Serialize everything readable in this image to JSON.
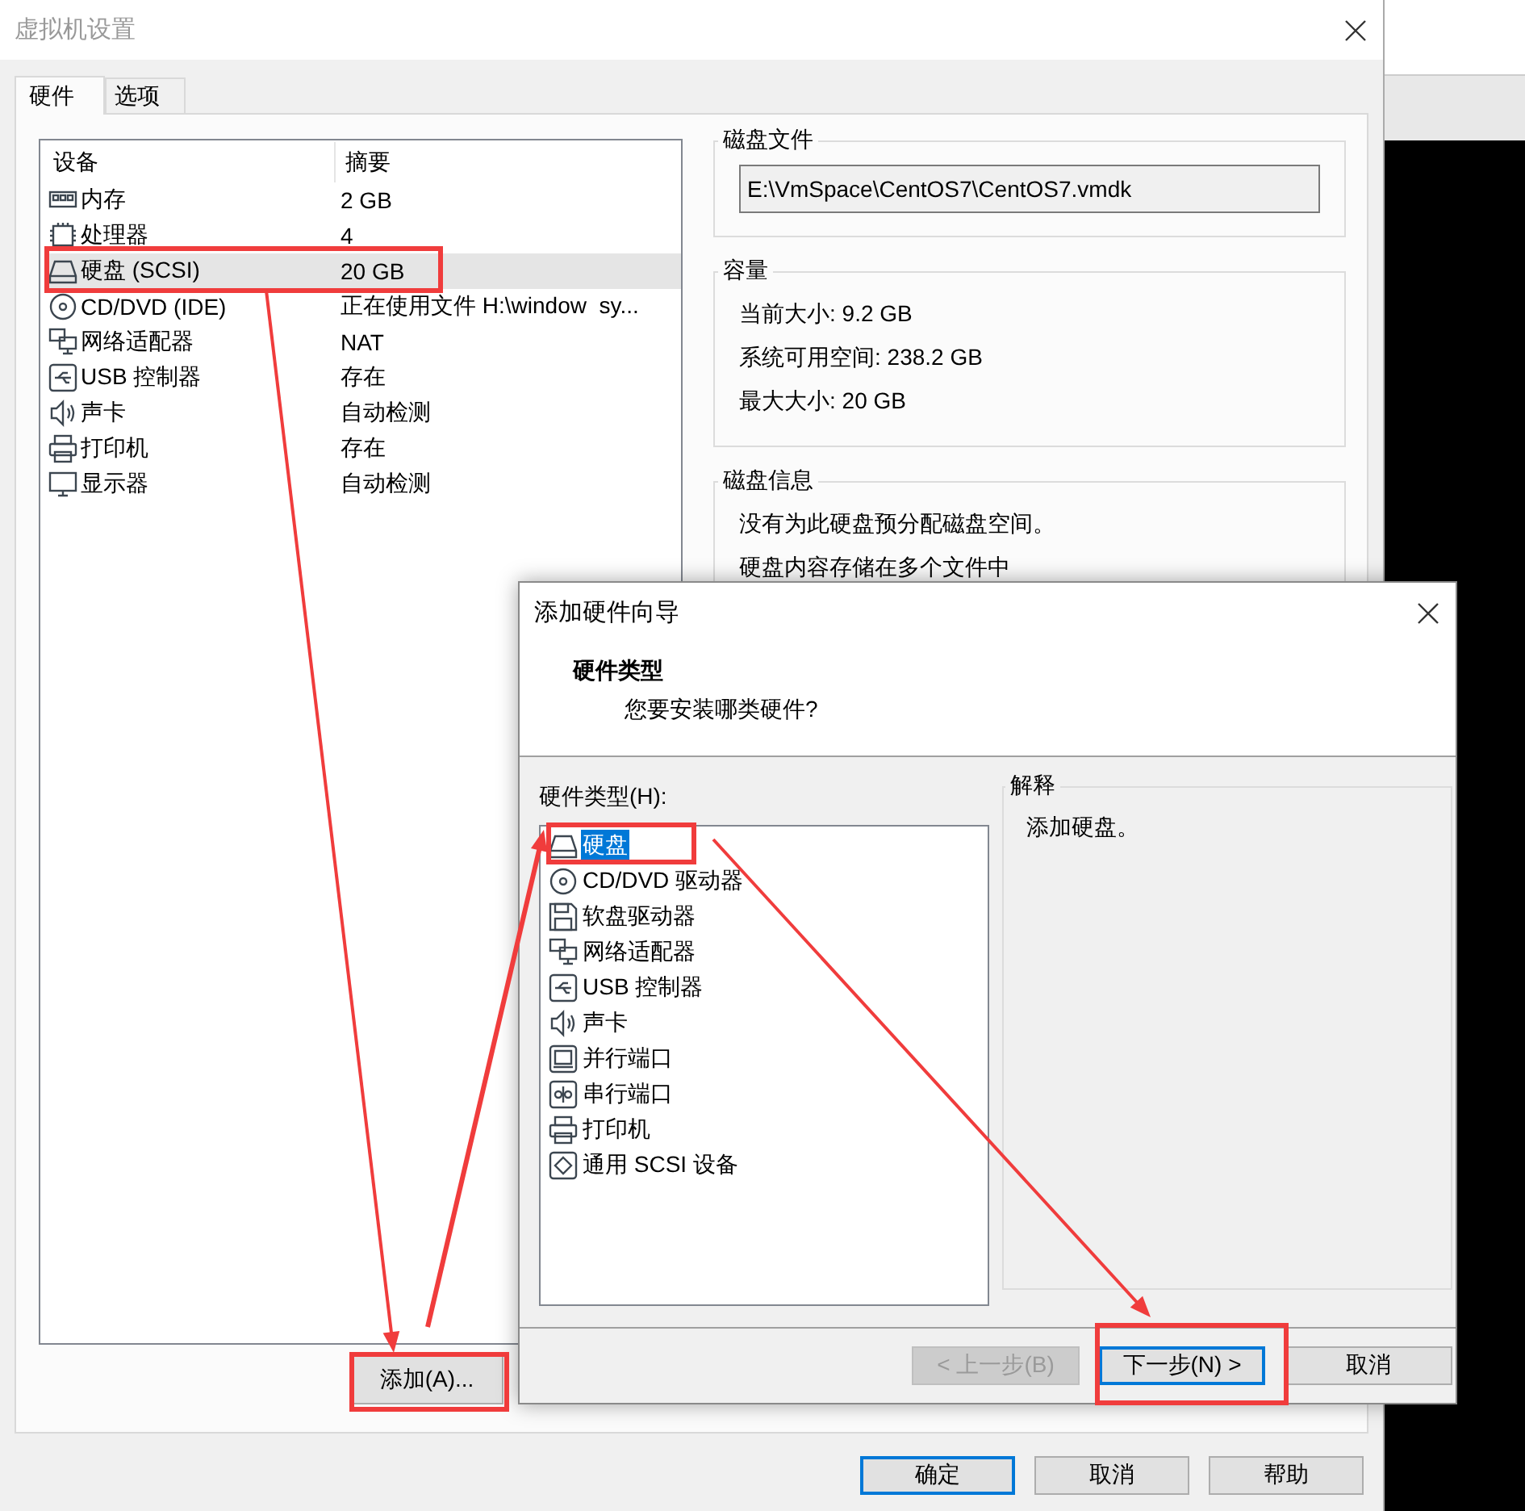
{
  "window": {
    "title": "虚拟机设置"
  },
  "tabs": [
    {
      "label": "硬件",
      "selected": true
    },
    {
      "label": "选项",
      "selected": false
    }
  ],
  "device_table": {
    "columns": [
      "设备",
      "摘要"
    ],
    "rows": [
      {
        "kind": "memory",
        "device": "内存",
        "summary": "2 GB",
        "selected": false
      },
      {
        "kind": "cpu",
        "device": "处理器",
        "summary": "4",
        "selected": false
      },
      {
        "kind": "disk",
        "device": "硬盘 (SCSI)",
        "summary": "20 GB",
        "selected": true
      },
      {
        "kind": "cdrom",
        "device": "CD/DVD (IDE)",
        "summary": "正在使用文件 H:\\window  sy...",
        "selected": false
      },
      {
        "kind": "network",
        "device": "网络适配器",
        "summary": "NAT",
        "selected": false
      },
      {
        "kind": "usb",
        "device": "USB 控制器",
        "summary": "存在",
        "selected": false
      },
      {
        "kind": "sound",
        "device": "声卡",
        "summary": "自动检测",
        "selected": false
      },
      {
        "kind": "printer",
        "device": "打印机",
        "summary": "存在",
        "selected": false
      },
      {
        "kind": "display",
        "device": "显示器",
        "summary": "自动检测",
        "selected": false
      }
    ]
  },
  "add_button": "添加(A)...",
  "disk_file": {
    "title": "磁盘文件",
    "value": "E:\\VmSpace\\CentOS7\\CentOS7.vmdk"
  },
  "capacity": {
    "title": "容量",
    "lines": [
      "当前大小: 9.2 GB",
      "系统可用空间: 238.2 GB",
      "最大大小: 20 GB"
    ]
  },
  "disk_info": {
    "title": "磁盘信息",
    "lines": [
      "没有为此硬盘预分配磁盘空间。",
      "硬盘内容存储在多个文件中"
    ]
  },
  "buttons": [
    {
      "label": "确定",
      "default": true
    },
    {
      "label": "取消",
      "default": false
    },
    {
      "label": "帮助",
      "default": false
    }
  ],
  "wizard": {
    "title": "添加硬件向导",
    "heading": "硬件类型",
    "subheading": "您要安装哪类硬件?",
    "list_label": "硬件类型(H):",
    "items": [
      {
        "kind": "disk",
        "label": "硬盘",
        "selected": true
      },
      {
        "kind": "cdrom",
        "label": "CD/DVD 驱动器",
        "selected": false
      },
      {
        "kind": "floppy",
        "label": "软盘驱动器",
        "selected": false
      },
      {
        "kind": "network",
        "label": "网络适配器",
        "selected": false
      },
      {
        "kind": "usb",
        "label": "USB 控制器",
        "selected": false
      },
      {
        "kind": "sound",
        "label": "声卡",
        "selected": false
      },
      {
        "kind": "parallel",
        "label": "并行端口",
        "selected": false
      },
      {
        "kind": "serial",
        "label": "串行端口",
        "selected": false
      },
      {
        "kind": "printer",
        "label": "打印机",
        "selected": false
      },
      {
        "kind": "scsi",
        "label": "通用 SCSI 设备",
        "selected": false
      }
    ],
    "explanation": {
      "title": "解释",
      "text": "添加硬盘。"
    },
    "buttons": [
      {
        "label": "< 上一步(B)",
        "disabled": true,
        "default": false
      },
      {
        "label": "下一步(N) >",
        "disabled": false,
        "default": true
      },
      {
        "label": "取消",
        "disabled": false,
        "default": false
      }
    ]
  }
}
